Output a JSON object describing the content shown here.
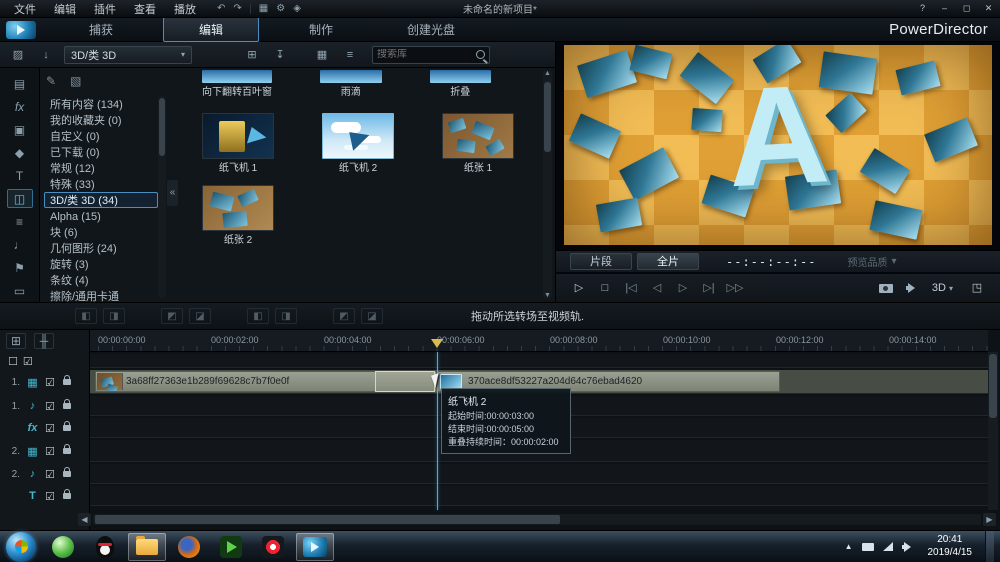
{
  "colors": {
    "accent": "#3c83b8",
    "highlight": "#5ec1e8",
    "clip_fill": "#949a8b",
    "checker_dark": "#d8952f",
    "checker_light": "#f2bd55"
  },
  "icons": {
    "undo": "↶",
    "redo": "↷",
    "display": "▦",
    "settings": "⚙",
    "magic": "◈",
    "help": "?",
    "minimize": "–",
    "maximize": "◻",
    "close": "✕",
    "media_import": "▨",
    "download": "↓",
    "new_folder": "⊞",
    "import_file": "↧",
    "grid_view": "▦",
    "list_view": "≡",
    "dropdown_arrow": "▾",
    "collapse": "«",
    "pen": "✎",
    "palette": "▧",
    "scroll_up": "▲",
    "scroll_down": "▼",
    "scroll_left": "◀",
    "scroll_right": "▶",
    "room_up": "∧",
    "room_down": "∨",
    "play": "▷",
    "stop": "□",
    "prev": "|◁",
    "step_back": "◁",
    "step_fwd": "▷",
    "next": "▷|",
    "ffwd": "▷▷",
    "expand": "◳",
    "track_manage": "⊞",
    "snap": "╫",
    "cb_on": "☑",
    "cb_off": "☐",
    "tg_a": "◧",
    "tg_b": "◨",
    "tg_c": "◩",
    "tg_d": "◪"
  },
  "titlebar": {
    "menus": [
      {
        "label": "文件"
      },
      {
        "label": "编辑"
      },
      {
        "label": "插件"
      },
      {
        "label": "查看"
      },
      {
        "label": "播放"
      }
    ],
    "project_title": "未命名的新项目*"
  },
  "modebar": {
    "tabs": [
      {
        "label": "捕获"
      },
      {
        "label": "编辑"
      },
      {
        "label": "制作"
      },
      {
        "label": "创建光盘"
      }
    ],
    "brand": "PowerDirector"
  },
  "library": {
    "filter_dropdown": "3D/类 3D",
    "search_placeholder": "搜索库",
    "rooms": [
      {
        "icon": "▤"
      },
      {
        "icon": "fx"
      },
      {
        "icon": "▣"
      },
      {
        "icon": "◆"
      },
      {
        "icon": "T"
      },
      {
        "icon": "◫"
      },
      {
        "icon": "≡"
      },
      {
        "icon": "♩"
      },
      {
        "icon": "⚑"
      },
      {
        "icon": "▭"
      }
    ],
    "categories": [
      {
        "label": "所有内容 (134)"
      },
      {
        "label": "我的收藏夹 (0)"
      },
      {
        "label": "自定义 (0)"
      },
      {
        "label": "已下载 (0)"
      },
      {
        "label": "常规 (12)"
      },
      {
        "label": "特殊 (33)"
      },
      {
        "label": "3D/类 3D (34)"
      },
      {
        "label": "Alpha (15)"
      },
      {
        "label": "块 (6)"
      },
      {
        "label": "几何图形 (24)"
      },
      {
        "label": "旋转 (3)"
      },
      {
        "label": "条纹 (4)"
      },
      {
        "label": "擦除/通用卡通"
      }
    ],
    "partial_items": [
      {
        "label": "向下翻转百叶窗"
      },
      {
        "label": "雨滴"
      },
      {
        "label": "折叠"
      }
    ],
    "items": [
      {
        "label": "纸飞机 1"
      },
      {
        "label": "纸飞机 2"
      },
      {
        "label": "纸张 1"
      },
      {
        "label": "纸张 2"
      }
    ]
  },
  "preview": {
    "letter": "A",
    "clip_mode": "片段",
    "movie_mode": "全片",
    "timecode": "--:--:--:--",
    "quality": "预览品质",
    "threed": "3D"
  },
  "transition_toolbar": {
    "hint": "拖动所选转场至视频轨."
  },
  "timeline": {
    "ruler_labels": [
      {
        "t": "00:00:00:00"
      },
      {
        "t": "00:00:02:00"
      },
      {
        "t": "00:00:04:00"
      },
      {
        "t": "00:00:06:00"
      },
      {
        "t": "00:00:08:00"
      },
      {
        "t": "00:00:10:00"
      },
      {
        "t": "00:00:12:00"
      },
      {
        "t": "00:00:14:00"
      }
    ],
    "tracks": [
      {
        "num": "1.",
        "icon": "▦",
        "kind": "video"
      },
      {
        "num": "1.",
        "icon": "♪",
        "kind": "audio"
      },
      {
        "num": "",
        "icon": "fx",
        "kind": "effect"
      },
      {
        "num": "2.",
        "icon": "▦",
        "kind": "video"
      },
      {
        "num": "2.",
        "icon": "♪",
        "kind": "audio"
      },
      {
        "num": "",
        "icon": "T",
        "kind": "title"
      }
    ],
    "clips": [
      {
        "name": "3a68ff27363e1b289f69628c7b7f0e0f"
      },
      {
        "name": "370ace8df53227a204d64c76ebad4620"
      }
    ],
    "tooltip": {
      "title": "纸飞机 2",
      "start": "起始时间:00:00:03:00",
      "end": "结束时间:00:00:05:00",
      "overlap": "重叠持续时间：00:00:02:00"
    }
  },
  "taskbar": {
    "time": "20:41",
    "date": "2019/4/15"
  }
}
